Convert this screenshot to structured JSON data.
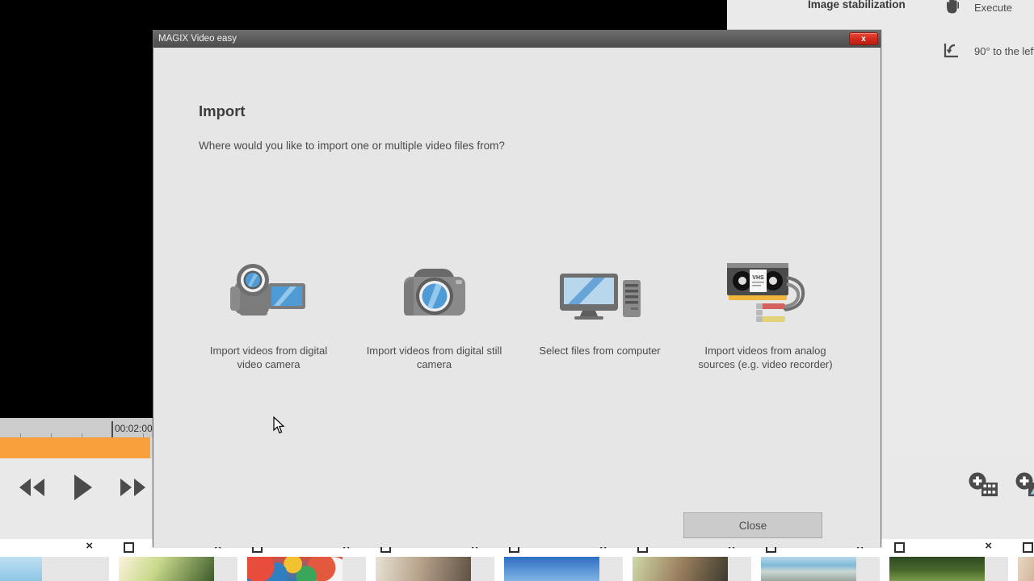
{
  "background": {
    "panel": {
      "title": "Image stabilization",
      "tools": [
        {
          "label": "Execute",
          "icon": "hand-icon"
        },
        {
          "label": "90° to the left",
          "icon": "rotate-left-icon"
        }
      ]
    },
    "timeline": {
      "timecode": "00:02:00",
      "clip_color": "#f9a03c"
    },
    "transport": {
      "rewind": "rewind-icon",
      "play": "play-icon",
      "forward": "fast-forward-icon"
    },
    "add_buttons": [
      {
        "icon": "add-video-icon"
      },
      {
        "icon": "add-photo-icon"
      }
    ],
    "filmstrip": {
      "close_label": "×",
      "items": [
        {
          "thumb": "beach-sky"
        },
        {
          "thumb": "sunlit-trees"
        },
        {
          "thumb": "colorful-balloons"
        },
        {
          "thumb": "indoor-people"
        },
        {
          "thumb": "blue-sky-kite"
        },
        {
          "thumb": "garden-group"
        },
        {
          "thumb": "man-at-beach"
        },
        {
          "thumb": "green-field"
        },
        {
          "thumb": "portrait-outdoor"
        }
      ]
    }
  },
  "dialog": {
    "window_title": "MAGIX Video easy",
    "close_button_glyph": "x",
    "heading": "Import",
    "subheading": "Where would you like to import one or multiple video files from?",
    "options": [
      {
        "icon": "camcorder-icon",
        "label": "Import videos from digital video camera"
      },
      {
        "icon": "still-camera-icon",
        "label": "Import videos from digital still camera"
      },
      {
        "icon": "desktop-computer-icon",
        "label": "Select files from computer"
      },
      {
        "icon": "vhs-cassette-icon",
        "label": "Import videos from analog sources (e.g. video recorder)"
      }
    ],
    "close_label": "Close"
  },
  "colors": {
    "dialog_bg": "#e6e6e6",
    "titlebar": "#5b5b5b",
    "close_red": "#d32b1c",
    "accent_blue": "#5b9bd5",
    "icon_gray": "#6e6e6e",
    "clip_orange": "#f9a03c",
    "text": "#4a4a4a"
  }
}
